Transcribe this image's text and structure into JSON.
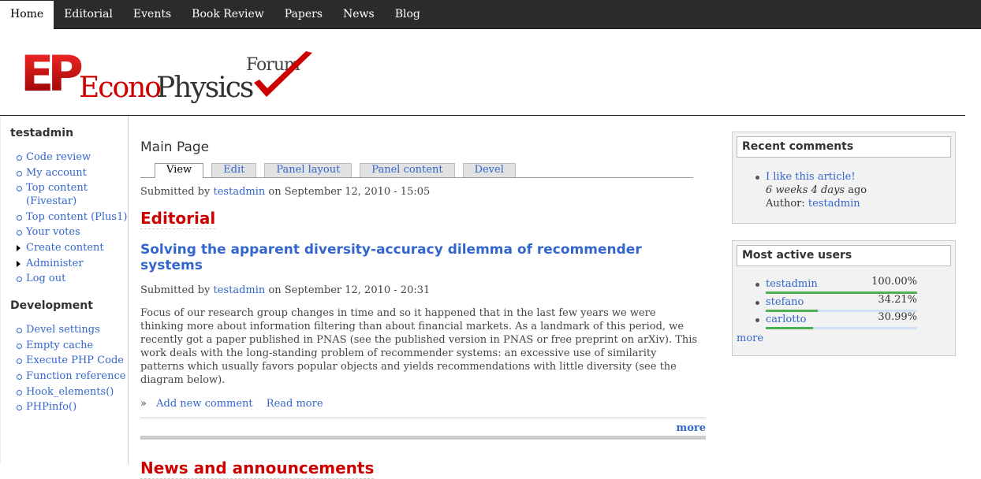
{
  "nav": {
    "items": [
      {
        "label": "Home",
        "active": true
      },
      {
        "label": "Editorial"
      },
      {
        "label": "Events"
      },
      {
        "label": "Book Review"
      },
      {
        "label": "Papers"
      },
      {
        "label": "News"
      },
      {
        "label": "Blog"
      }
    ]
  },
  "logo": {
    "letters": "EP",
    "econo": "Econo",
    "physics": "Physics",
    "forum": "Forum"
  },
  "sidebar": {
    "user_block": {
      "title": "testadmin",
      "items": [
        {
          "label": "Code review"
        },
        {
          "label": "My account"
        },
        {
          "label": "Top content (Fivestar)"
        },
        {
          "label": "Top content (Plus1)"
        },
        {
          "label": "Your votes"
        },
        {
          "label": "Create content",
          "collapsed": true
        },
        {
          "label": "Administer",
          "collapsed": true
        },
        {
          "label": "Log out"
        }
      ]
    },
    "dev_block": {
      "title": "Development",
      "items": [
        {
          "label": "Devel settings"
        },
        {
          "label": "Empty cache"
        },
        {
          "label": "Execute PHP Code"
        },
        {
          "label": "Function reference"
        },
        {
          "label": "Hook_elements()"
        },
        {
          "label": "PHPinfo()"
        }
      ]
    }
  },
  "main": {
    "title": "Main Page",
    "tabs": [
      {
        "label": "View",
        "active": true
      },
      {
        "label": "Edit"
      },
      {
        "label": "Panel layout"
      },
      {
        "label": "Panel content"
      },
      {
        "label": "Devel"
      }
    ],
    "submitted": {
      "prefix": "Submitted by",
      "author": "testadmin",
      "date": "on September 12, 2010 - 15:05"
    },
    "editorial_heading": "Editorial",
    "article": {
      "title": "Solving the apparent diversity-accuracy dilemma of recommender systems",
      "submitted_prefix": "Submitted by",
      "author": "testadmin",
      "date": "on September 12, 2010 - 20:31",
      "body": "Focus of our research group changes in time and so it happened that in the last few years we were thinking more about information filtering than about financial markets. As a landmark of this period, we recently got a paper published in PNAS (see the published version in PNAS or free preprint on arXiv). This work deals with the long-standing problem of recommender systems: an excessive use of similarity patterns which usually favors popular objects and yields recommendations with little diversity (see the diagram below).",
      "links_marker": "»",
      "add_comment": "Add new comment",
      "read_more": "Read more"
    },
    "more": "more",
    "news_heading": "News and announcements"
  },
  "recent_comments": {
    "title": "Recent comments",
    "items": [
      {
        "link": "I like this article!",
        "ago_em": "6 weeks 4 days",
        "ago_suffix": " ago",
        "author_prefix": "Author: ",
        "author": "testadmin"
      }
    ]
  },
  "active_users": {
    "title": "Most active users",
    "users": [
      {
        "name": "testadmin",
        "pct_label": "100.00%",
        "pct": 1.0
      },
      {
        "name": "stefano",
        "pct_label": "34.21%",
        "pct": 0.3421
      },
      {
        "name": "carlotto",
        "pct_label": "30.99%",
        "pct": 0.3099
      }
    ],
    "more": "more"
  },
  "colors": {
    "accent_link": "#3366cc",
    "heading_red": "#cc0000",
    "nav_bg": "#2b2b2b",
    "bar_green": "#4caf50"
  }
}
